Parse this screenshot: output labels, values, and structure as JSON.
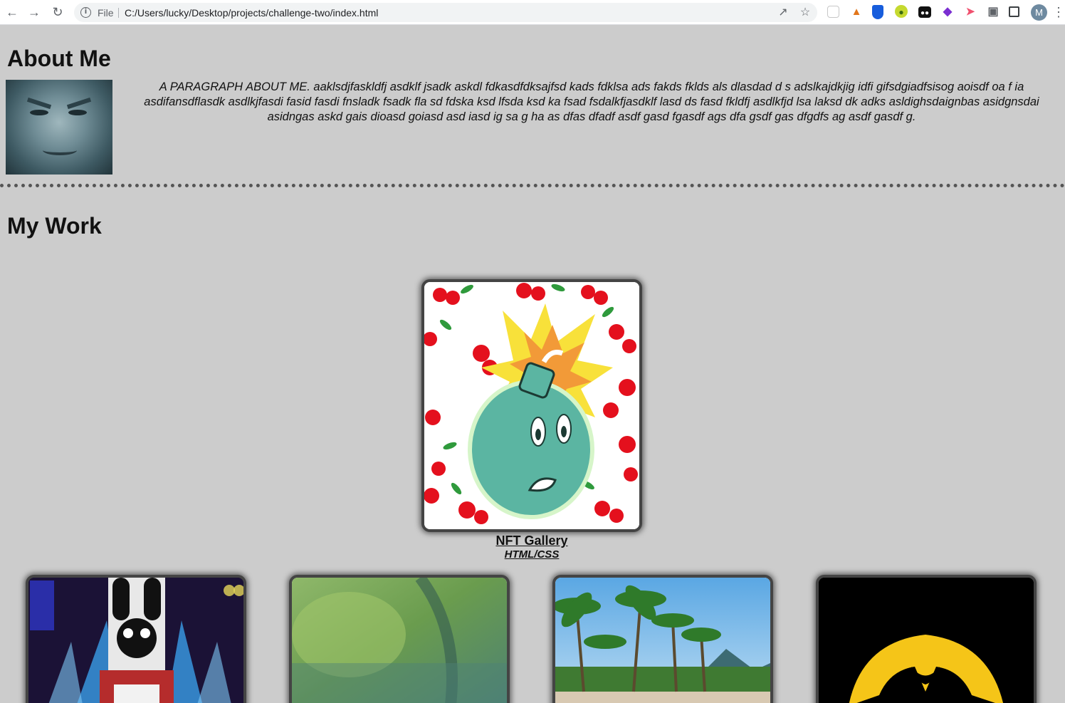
{
  "browser": {
    "file_label": "File",
    "url": "C:/Users/lucky/Desktop/projects/challenge-two/index.html",
    "avatar_letter": "M",
    "extensions": [
      "reader-icon",
      "metamask-fox-icon",
      "bitwarden-shield-icon",
      "green-extension-icon",
      "glasses-icon",
      "gem-icon",
      "arrow-extension-icon",
      "puzzle-icon",
      "side-panel-icon"
    ]
  },
  "about": {
    "heading": "About Me",
    "paragraph": "A PARAGRAPH ABOUT ME. aaklsdjfaskldfj asdklf jsadk askdl fdkasdfdksajfsd kads fdklsa ads fakds fklds als dlasdad d s adslkajdkjig idfi gifsdgiadfsisog aoisdf oa f ia asdifansdflasdk asdlkjfasdi fasid fasdi fnsladk fsadk fla sd fdska ksd lfsda ksd ka fsad fsdalkfjasdklf lasd ds fasd fkldfj asdlkfjd lsa laksd dk adks asldighsdaignbas asidgnsdai asidngas askd gais dioasd goiasd asd iasd ig sa g ha as dfas dfadf asdf gasd fgasdf ags dfa gsdf gas dfgdfs ag asdf gasdf g."
  },
  "work": {
    "heading": "My Work",
    "featured": {
      "title": "NFT Gallery",
      "subtitle": "HTML/CSS"
    },
    "projects": [
      {
        "name": "project-card-robot"
      },
      {
        "name": "project-card-blurred-green"
      },
      {
        "name": "project-card-beach-palms"
      },
      {
        "name": "project-card-wutang-logo"
      }
    ]
  },
  "colors": {
    "page_bg": "#cccccc",
    "card_border": "#444444",
    "bomb_teal": "#5bb5a2",
    "cherry_red": "#e4101d"
  }
}
